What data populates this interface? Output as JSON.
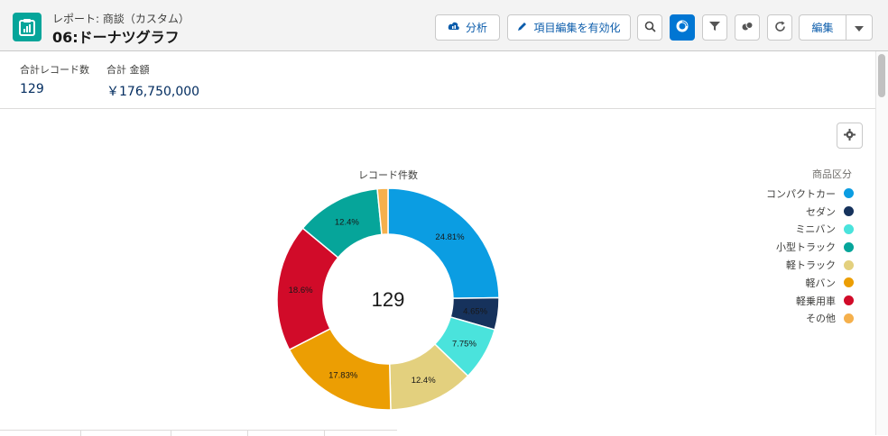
{
  "header": {
    "subtitle": "レポート: 商談（カスタム）",
    "title": "06:ドーナツグラフ"
  },
  "toolbar": {
    "analyze_label": "分析",
    "edit_fields_label": "項目編集を有効化",
    "edit_label": "編集"
  },
  "summary": {
    "total_records_label": "合計レコード数",
    "total_records_value": "129",
    "total_amount_label": "合計 金額",
    "total_amount_value": "￥176,750,000"
  },
  "chart_data": {
    "type": "pie",
    "style": "donut",
    "title": "レコード件数",
    "center_label": "129",
    "legend_title": "商品区分",
    "legend_position": "right",
    "categories": [
      "コンパクトカー",
      "セダン",
      "ミニバン",
      "小型トラック",
      "軽トラック",
      "軽バン",
      "軽乗用車",
      "その他"
    ],
    "values": [
      24.81,
      4.65,
      7.75,
      12.4,
      12.4,
      17.83,
      18.6,
      1.55
    ],
    "labels": [
      "24.81%",
      "4.65%",
      "7.75%",
      "",
      "12.4%",
      "17.83%",
      "18.6%",
      ""
    ],
    "label_order": [
      "コンパクトカー",
      "セダン",
      "ミニバン",
      "軽トラック",
      "軽バン",
      "軽乗用車",
      "小型トラック"
    ],
    "colors": [
      "#0b9de2",
      "#16325c",
      "#4ae3dc",
      "#06a59a",
      "#e3d07e",
      "#ec9e03",
      "#d10b29",
      "#f5b04c"
    ],
    "slice_order": [
      0,
      1,
      2,
      4,
      5,
      6,
      3,
      7
    ],
    "slice_labels": [
      "24.81%",
      "4.65%",
      "7.75%",
      "12.4%",
      "17.83%",
      "18.6%",
      "12.4%",
      ""
    ]
  }
}
